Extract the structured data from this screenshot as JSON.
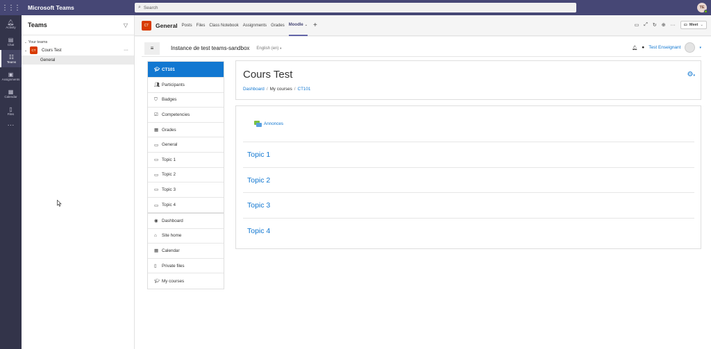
{
  "app": {
    "title": "Microsoft Teams",
    "search_placeholder": "Search",
    "user_initials": "TE"
  },
  "rail": [
    {
      "label": "Activity",
      "icon": "bell-icon"
    },
    {
      "label": "Chat",
      "icon": "chat-icon"
    },
    {
      "label": "Teams",
      "icon": "teams-icon"
    },
    {
      "label": "Assignments",
      "icon": "assignments-icon"
    },
    {
      "label": "Calendar",
      "icon": "calendar-icon"
    },
    {
      "label": "Files",
      "icon": "files-icon"
    }
  ],
  "teams_panel": {
    "title": "Teams",
    "section": "Your teams",
    "team": {
      "badge": "CT",
      "name": "Cours Test"
    },
    "channel": "General"
  },
  "channel_header": {
    "badge": "CT",
    "name": "General",
    "tabs": [
      "Posts",
      "Files",
      "Class Notebook",
      "Assignments",
      "Grades",
      "Moodle"
    ],
    "active_tab": "Moodle",
    "meet_label": "Meet"
  },
  "moodle": {
    "site_name": "Instance de test teams-sandbox",
    "language": "English (en)",
    "user_name": "Test Enseignant",
    "nav": [
      {
        "label": "CT101",
        "icon": "graduation-cap-icon"
      },
      {
        "label": "Participants",
        "icon": "users-icon"
      },
      {
        "label": "Badges",
        "icon": "shield-icon"
      },
      {
        "label": "Competencies",
        "icon": "checkbox-icon"
      },
      {
        "label": "Grades",
        "icon": "table-icon"
      },
      {
        "label": "General",
        "icon": "folder-icon"
      },
      {
        "label": "Topic 1",
        "icon": "folder-icon"
      },
      {
        "label": "Topic 2",
        "icon": "folder-icon"
      },
      {
        "label": "Topic 3",
        "icon": "folder-icon"
      },
      {
        "label": "Topic 4",
        "icon": "folder-icon"
      }
    ],
    "nav2": [
      {
        "label": "Dashboard",
        "icon": "dashboard-icon"
      },
      {
        "label": "Site home",
        "icon": "home-icon"
      },
      {
        "label": "Calendar",
        "icon": "calendar-icon"
      },
      {
        "label": "Private files",
        "icon": "file-icon"
      },
      {
        "label": "My courses",
        "icon": "graduation-cap-icon"
      }
    ],
    "course_title": "Cours Test",
    "breadcrumbs": [
      "Dashboard",
      "My courses",
      "CT101"
    ],
    "announcements": "Annonces",
    "topics": [
      "Topic 1",
      "Topic 2",
      "Topic 3",
      "Topic 4"
    ]
  }
}
